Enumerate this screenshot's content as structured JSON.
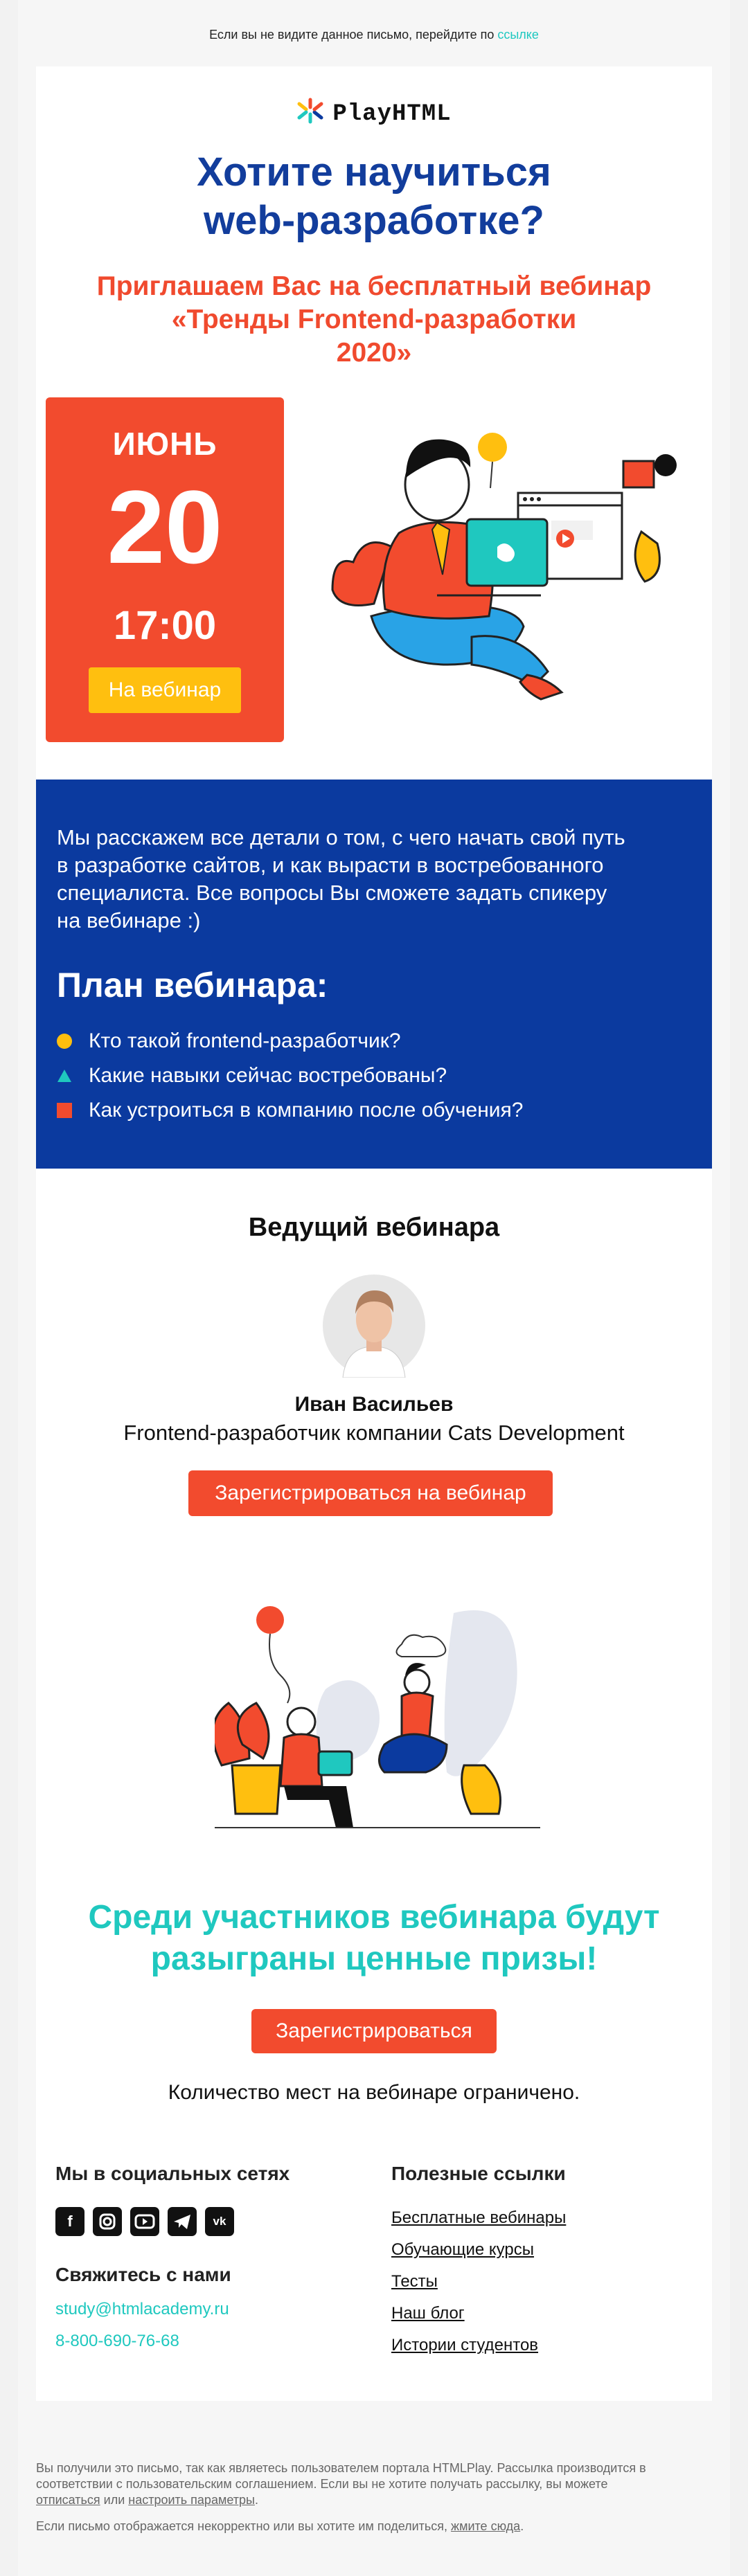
{
  "preheader": {
    "text": "Если вы не видите данное письмо, перейдите по ",
    "link": "ссылке"
  },
  "brand": {
    "name": "PlayHTML"
  },
  "hero": {
    "title_line1": "Хотите научиться",
    "title_line2": "web-разработке?",
    "subtitle_line1": "Приглашаем Вас на бесплатный вебинар",
    "subtitle_line2": "«Тренды Frontend-разработки",
    "subtitle_line3": "2020»"
  },
  "date": {
    "month": "ИЮНЬ",
    "day": "20",
    "time": "17:00",
    "button": "На вебинар"
  },
  "intro": {
    "line1": "Мы расскажем все детали о том, с чего начать свой путь",
    "line2": "в разработке сайтов, и как вырасти в востребованного",
    "line3": "специалиста. Все вопросы Вы сможете задать спикеру",
    "line4": "на вебинаре :)"
  },
  "plan": {
    "title": "План вебинара:",
    "items": [
      "Кто такой frontend-разработчик?",
      "Какие навыки сейчас востребованы?",
      "Как устроиться в компанию после обучения?"
    ]
  },
  "speaker": {
    "section_title": "Ведущий вебинара",
    "name": "Иван Васильев",
    "role": "Frontend-разработчик компании Cats Development",
    "button": "Зарегистрироваться на вебинар"
  },
  "prizes": {
    "line1": "Среди участников вебинара будут",
    "line2": "разыграны ценные призы!",
    "button": "Зарегистрироваться",
    "limit": "Количество мест на вебинаре ограничено."
  },
  "footer": {
    "social_title": "Мы в социальных сетях",
    "social_icons": [
      "facebook-icon",
      "instagram-icon",
      "youtube-icon",
      "telegram-icon",
      "vk-icon"
    ],
    "contact_title": "Свяжитесь с нами",
    "email": "study@htmlacademy.ru",
    "phone": "8-800-690-76-68",
    "links_title": "Полезные ссылки",
    "links": [
      "Бесплатные вебинары",
      "Обучающие курсы",
      "Тесты",
      "Наш блог",
      "Истории студентов"
    ]
  },
  "legal": {
    "line1": "Вы получили это письмо, так как являетесь пользователем портала HTMLPlay. Рассылка производится в",
    "line2": "соответствии с пользовательским соглашением. Если вы не хотите получать рассылку, вы можете",
    "unsubscribe": "отписаться",
    "or": " или ",
    "settings": "настроить параметры",
    "dot": ".",
    "line3": "Если письмо отображается некорректно или вы хотите им поделиться, ",
    "webversion": "жмите сюда",
    "end": "."
  },
  "colors": {
    "blue": "#0b3a9f",
    "red": "#f24b2e",
    "yellow": "#ffbf0f",
    "teal": "#1fc8bf"
  }
}
